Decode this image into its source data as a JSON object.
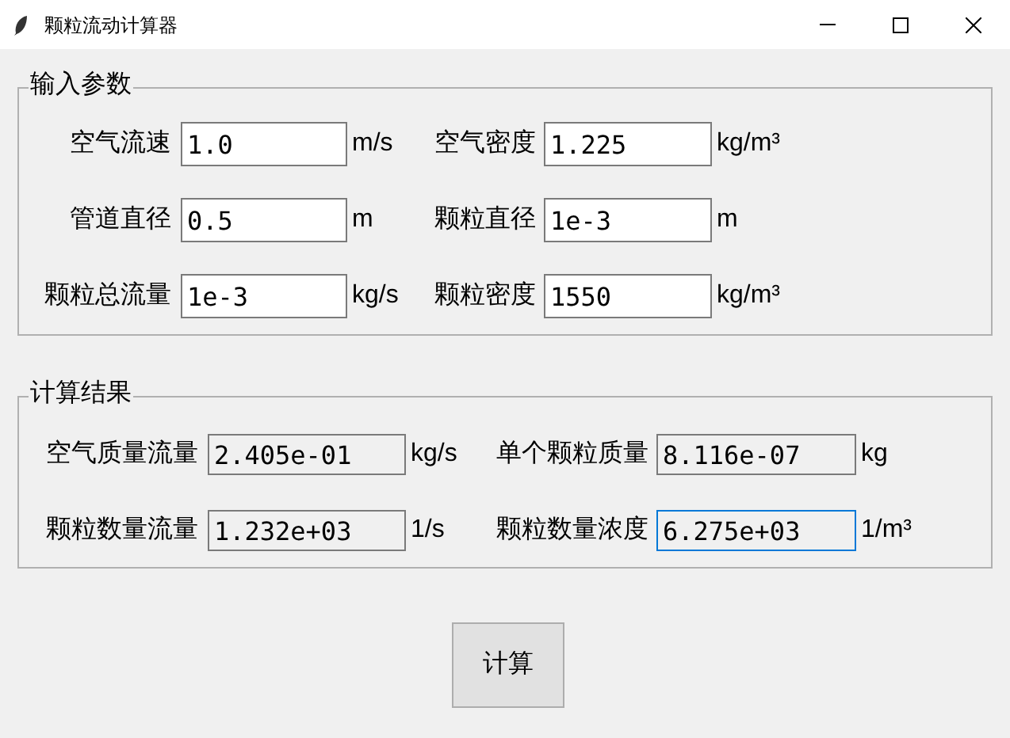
{
  "window": {
    "title": "颗粒流动计算器"
  },
  "input_section": {
    "title": "输入参数",
    "rows": [
      {
        "left": {
          "label": "空气流速",
          "value": "1.0",
          "unit": "m/s"
        },
        "right": {
          "label": "空气密度",
          "value": "1.225",
          "unit": "kg/m³"
        }
      },
      {
        "left": {
          "label": "管道直径",
          "value": "0.5",
          "unit": "m"
        },
        "right": {
          "label": "颗粒直径",
          "value": "1e-3",
          "unit": "m"
        }
      },
      {
        "left": {
          "label": "颗粒总流量",
          "value": "1e-3",
          "unit": "kg/s"
        },
        "right": {
          "label": "颗粒密度",
          "value": "1550",
          "unit": "kg/m³"
        }
      }
    ]
  },
  "result_section": {
    "title": "计算结果",
    "rows": [
      {
        "left": {
          "label": "空气质量流量",
          "value": "2.405e-01",
          "unit": "kg/s",
          "focused": false
        },
        "right": {
          "label": "单个颗粒质量",
          "value": "8.116e-07",
          "unit": "kg",
          "focused": false
        }
      },
      {
        "left": {
          "label": "颗粒数量流量",
          "value": "1.232e+03",
          "unit": "1/s",
          "focused": false
        },
        "right": {
          "label": "颗粒数量浓度",
          "value": "6.275e+03",
          "unit": "1/m³",
          "focused": true
        }
      }
    ]
  },
  "button": "计算"
}
